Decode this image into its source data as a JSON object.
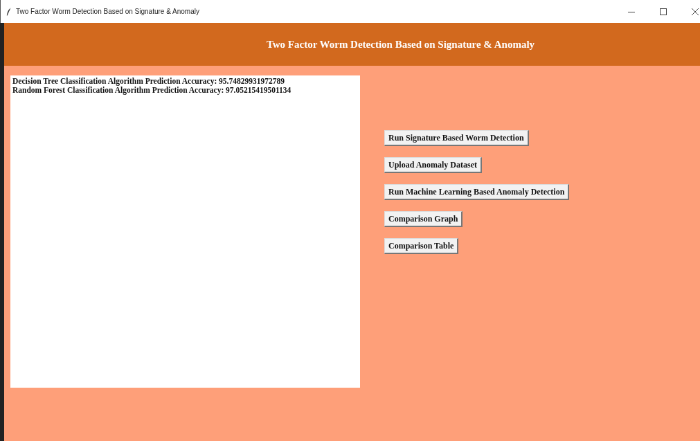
{
  "window": {
    "title": "Two Factor Worm Detection Based on Signature & Anomaly"
  },
  "header": {
    "title": "Two Factor Worm Detection Based on Signature & Anomaly"
  },
  "output": {
    "lines": [
      "Decision Tree Classification Algorithm Prediction Accuracy: 95.74829931972789",
      "Random Forest Classification Algorithm Prediction Accuracy: 97.05215419501134"
    ]
  },
  "buttons": [
    "Run Signature Based Worm Detection",
    "Upload Anomaly Dataset",
    "Run Machine Learning Based Anomaly Detection",
    "Comparison Graph",
    "Comparison Table"
  ]
}
